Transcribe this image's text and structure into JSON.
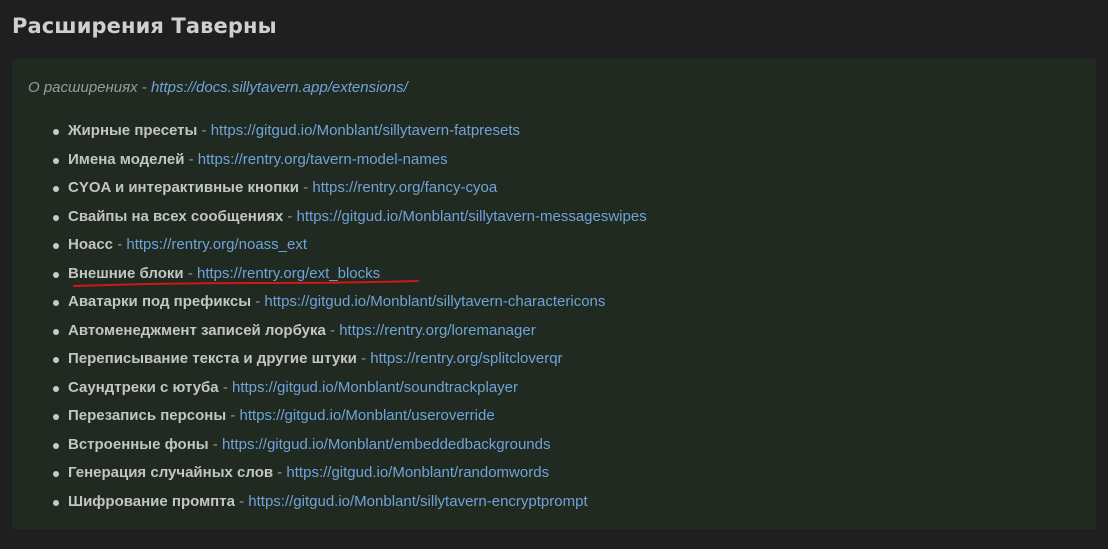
{
  "title": "Расширения Таверны",
  "intro": {
    "label": "О расширениях",
    "separator": " - ",
    "url": "https://docs.sillytavern.app/extensions/"
  },
  "separator": " - ",
  "extensions": [
    {
      "name": "Жирные пресеты",
      "url": "https://gitgud.io/Monblant/sillytavern-fatpresets"
    },
    {
      "name": "Имена моделей",
      "url": "https://rentry.org/tavern-model-names"
    },
    {
      "name": "CYOA и интерактивные кнопки",
      "url": "https://rentry.org/fancy-cyoa"
    },
    {
      "name": "Свайпы на всех сообщениях",
      "url": "https://gitgud.io/Monblant/sillytavern-messageswipes"
    },
    {
      "name": "Ноасс",
      "url": "https://rentry.org/noass_ext"
    },
    {
      "name": "Внешние блоки",
      "url": "https://rentry.org/ext_blocks",
      "highlighted": true
    },
    {
      "name": "Аватарки под префиксы",
      "url": "https://gitgud.io/Monblant/sillytavern-charactericons"
    },
    {
      "name": "Автоменеджмент записей лорбука",
      "url": "https://rentry.org/loremanager"
    },
    {
      "name": "Переписывание текста и другие штуки",
      "url": "https://rentry.org/splitcloverqr"
    },
    {
      "name": "Саундтреки с ютуба",
      "url": "https://gitgud.io/Monblant/soundtrackplayer"
    },
    {
      "name": "Перезапись персоны",
      "url": "https://gitgud.io/Monblant/useroverride"
    },
    {
      "name": "Встроенные фоны",
      "url": "https://gitgud.io/Monblant/embeddedbackgrounds"
    },
    {
      "name": "Генерация случайных слов",
      "url": "https://gitgud.io/Monblant/randomwords"
    },
    {
      "name": "Шифрование промпта",
      "url": "https://gitgud.io/Monblant/sillytavern-encryptprompt"
    }
  ],
  "colors": {
    "background": "#1f1f1f",
    "panel": "#212a21",
    "link": "#6fa3d8",
    "highlight_underline": "#d01818"
  }
}
